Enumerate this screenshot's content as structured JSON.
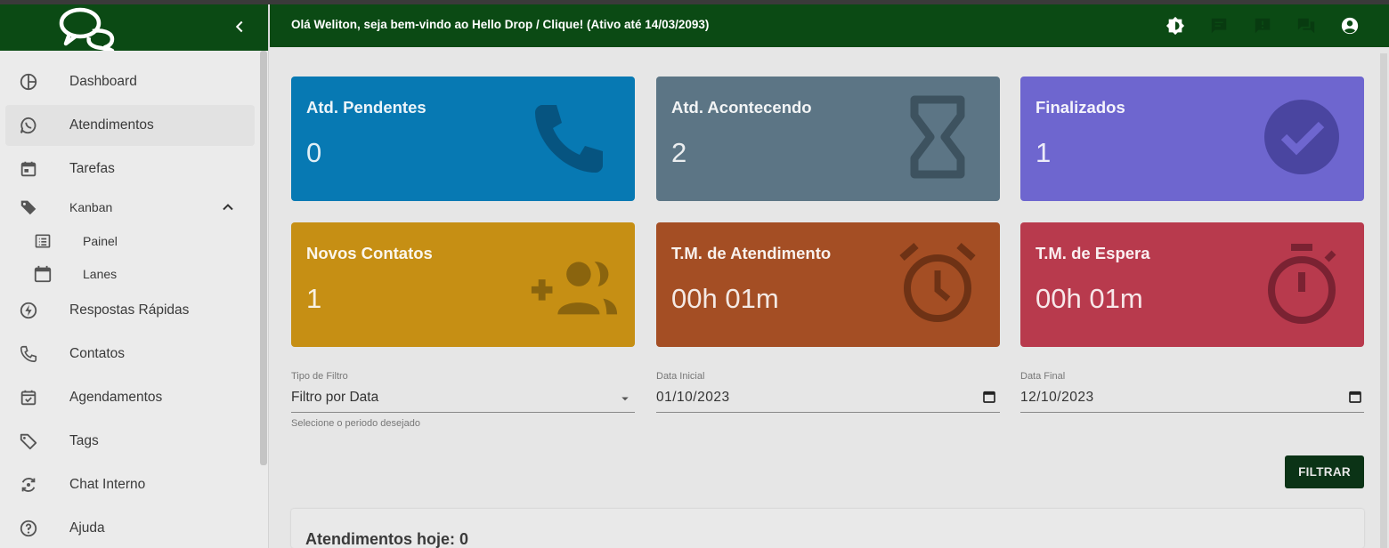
{
  "header": {
    "greeting": "Olá Weliton, seja bem-vindo ao Hello Drop / Clique! (Ativo até 14/03/2093)",
    "icons": [
      "brightness-icon",
      "chat-icon",
      "alert-icon",
      "forum-icon",
      "account-icon"
    ]
  },
  "sidebar": {
    "collapse_icon": "chevron-left-icon",
    "items": [
      {
        "label": "Dashboard",
        "icon": "dashboard-icon"
      },
      {
        "label": "Atendimentos",
        "icon": "whatsapp-icon"
      },
      {
        "label": "Tarefas",
        "icon": "calendar-icon"
      },
      {
        "label": "Kanban",
        "icon": "tag-icon"
      },
      {
        "label": "Painel",
        "icon": "list-icon"
      },
      {
        "label": "Lanes",
        "icon": "calendar-blank-icon"
      },
      {
        "label": "Respostas Rápidas",
        "icon": "flash-icon"
      },
      {
        "label": "Contatos",
        "icon": "phone-icon"
      },
      {
        "label": "Agendamentos",
        "icon": "calendar-check-icon"
      },
      {
        "label": "Tags",
        "icon": "tag-outline-icon"
      },
      {
        "label": "Chat Interno",
        "icon": "sync-chat-icon"
      },
      {
        "label": "Ajuda",
        "icon": "help-icon"
      }
    ]
  },
  "cards": [
    {
      "title": "Atd. Pendentes",
      "value": "0",
      "color": "#0779b3",
      "icon": "phone-icon"
    },
    {
      "title": "Atd. Acontecendo",
      "value": "2",
      "color": "#5c7585",
      "icon": "hourglass-icon"
    },
    {
      "title": "Finalizados",
      "value": "1",
      "color": "#6e66cf",
      "icon": "check-circle-icon"
    },
    {
      "title": "Novos Contatos",
      "value": "1",
      "color": "#c68f14",
      "icon": "add-group-icon"
    },
    {
      "title": "T.M. de Atendimento",
      "value": "00h 01m",
      "color": "#a44e24",
      "icon": "alarm-icon"
    },
    {
      "title": "T.M. de Espera",
      "value": "00h 01m",
      "color": "#b83a4d",
      "icon": "timer-icon"
    }
  ],
  "filters": {
    "tipo": {
      "label": "Tipo de Filtro",
      "value": "Filtro por Data",
      "help": "Selecione o periodo desejado"
    },
    "data_inicial": {
      "label": "Data Inicial",
      "value": "01/10/2023"
    },
    "data_final": {
      "label": "Data Final",
      "value": "12/10/2023"
    },
    "button": "FILTRAR"
  },
  "panel": {
    "title": "Atendimentos hoje: 0"
  }
}
